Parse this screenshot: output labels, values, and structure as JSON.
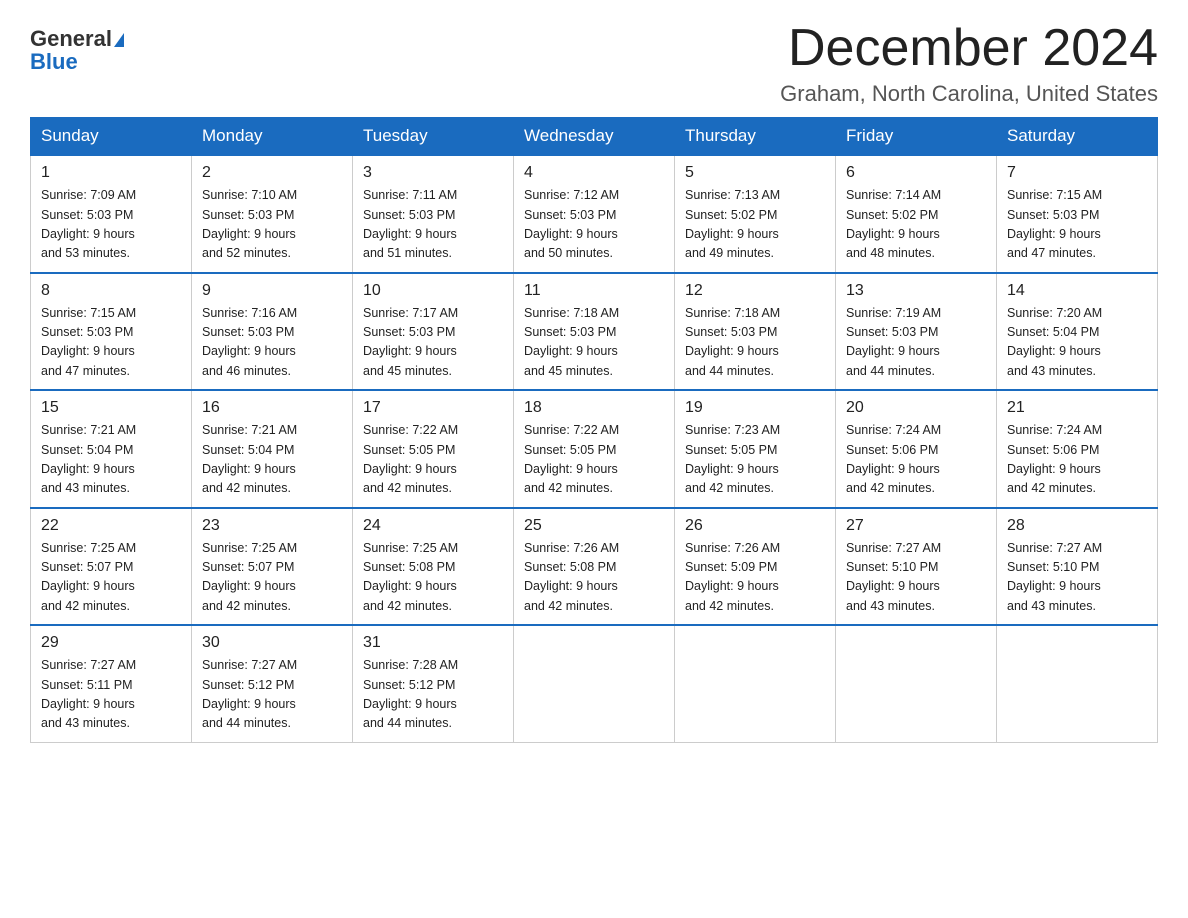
{
  "header": {
    "logo_general": "General",
    "logo_blue": "Blue",
    "month_title": "December 2024",
    "location": "Graham, North Carolina, United States"
  },
  "days_of_week": [
    "Sunday",
    "Monday",
    "Tuesday",
    "Wednesday",
    "Thursday",
    "Friday",
    "Saturday"
  ],
  "weeks": [
    [
      {
        "day": "1",
        "sunrise": "7:09 AM",
        "sunset": "5:03 PM",
        "daylight": "9 hours and 53 minutes."
      },
      {
        "day": "2",
        "sunrise": "7:10 AM",
        "sunset": "5:03 PM",
        "daylight": "9 hours and 52 minutes."
      },
      {
        "day": "3",
        "sunrise": "7:11 AM",
        "sunset": "5:03 PM",
        "daylight": "9 hours and 51 minutes."
      },
      {
        "day": "4",
        "sunrise": "7:12 AM",
        "sunset": "5:03 PM",
        "daylight": "9 hours and 50 minutes."
      },
      {
        "day": "5",
        "sunrise": "7:13 AM",
        "sunset": "5:02 PM",
        "daylight": "9 hours and 49 minutes."
      },
      {
        "day": "6",
        "sunrise": "7:14 AM",
        "sunset": "5:02 PM",
        "daylight": "9 hours and 48 minutes."
      },
      {
        "day": "7",
        "sunrise": "7:15 AM",
        "sunset": "5:03 PM",
        "daylight": "9 hours and 47 minutes."
      }
    ],
    [
      {
        "day": "8",
        "sunrise": "7:15 AM",
        "sunset": "5:03 PM",
        "daylight": "9 hours and 47 minutes."
      },
      {
        "day": "9",
        "sunrise": "7:16 AM",
        "sunset": "5:03 PM",
        "daylight": "9 hours and 46 minutes."
      },
      {
        "day": "10",
        "sunrise": "7:17 AM",
        "sunset": "5:03 PM",
        "daylight": "9 hours and 45 minutes."
      },
      {
        "day": "11",
        "sunrise": "7:18 AM",
        "sunset": "5:03 PM",
        "daylight": "9 hours and 45 minutes."
      },
      {
        "day": "12",
        "sunrise": "7:18 AM",
        "sunset": "5:03 PM",
        "daylight": "9 hours and 44 minutes."
      },
      {
        "day": "13",
        "sunrise": "7:19 AM",
        "sunset": "5:03 PM",
        "daylight": "9 hours and 44 minutes."
      },
      {
        "day": "14",
        "sunrise": "7:20 AM",
        "sunset": "5:04 PM",
        "daylight": "9 hours and 43 minutes."
      }
    ],
    [
      {
        "day": "15",
        "sunrise": "7:21 AM",
        "sunset": "5:04 PM",
        "daylight": "9 hours and 43 minutes."
      },
      {
        "day": "16",
        "sunrise": "7:21 AM",
        "sunset": "5:04 PM",
        "daylight": "9 hours and 42 minutes."
      },
      {
        "day": "17",
        "sunrise": "7:22 AM",
        "sunset": "5:05 PM",
        "daylight": "9 hours and 42 minutes."
      },
      {
        "day": "18",
        "sunrise": "7:22 AM",
        "sunset": "5:05 PM",
        "daylight": "9 hours and 42 minutes."
      },
      {
        "day": "19",
        "sunrise": "7:23 AM",
        "sunset": "5:05 PM",
        "daylight": "9 hours and 42 minutes."
      },
      {
        "day": "20",
        "sunrise": "7:24 AM",
        "sunset": "5:06 PM",
        "daylight": "9 hours and 42 minutes."
      },
      {
        "day": "21",
        "sunrise": "7:24 AM",
        "sunset": "5:06 PM",
        "daylight": "9 hours and 42 minutes."
      }
    ],
    [
      {
        "day": "22",
        "sunrise": "7:25 AM",
        "sunset": "5:07 PM",
        "daylight": "9 hours and 42 minutes."
      },
      {
        "day": "23",
        "sunrise": "7:25 AM",
        "sunset": "5:07 PM",
        "daylight": "9 hours and 42 minutes."
      },
      {
        "day": "24",
        "sunrise": "7:25 AM",
        "sunset": "5:08 PM",
        "daylight": "9 hours and 42 minutes."
      },
      {
        "day": "25",
        "sunrise": "7:26 AM",
        "sunset": "5:08 PM",
        "daylight": "9 hours and 42 minutes."
      },
      {
        "day": "26",
        "sunrise": "7:26 AM",
        "sunset": "5:09 PM",
        "daylight": "9 hours and 42 minutes."
      },
      {
        "day": "27",
        "sunrise": "7:27 AM",
        "sunset": "5:10 PM",
        "daylight": "9 hours and 43 minutes."
      },
      {
        "day": "28",
        "sunrise": "7:27 AM",
        "sunset": "5:10 PM",
        "daylight": "9 hours and 43 minutes."
      }
    ],
    [
      {
        "day": "29",
        "sunrise": "7:27 AM",
        "sunset": "5:11 PM",
        "daylight": "9 hours and 43 minutes."
      },
      {
        "day": "30",
        "sunrise": "7:27 AM",
        "sunset": "5:12 PM",
        "daylight": "9 hours and 44 minutes."
      },
      {
        "day": "31",
        "sunrise": "7:28 AM",
        "sunset": "5:12 PM",
        "daylight": "9 hours and 44 minutes."
      },
      null,
      null,
      null,
      null
    ]
  ],
  "labels": {
    "sunrise": "Sunrise:",
    "sunset": "Sunset:",
    "daylight": "Daylight:"
  }
}
